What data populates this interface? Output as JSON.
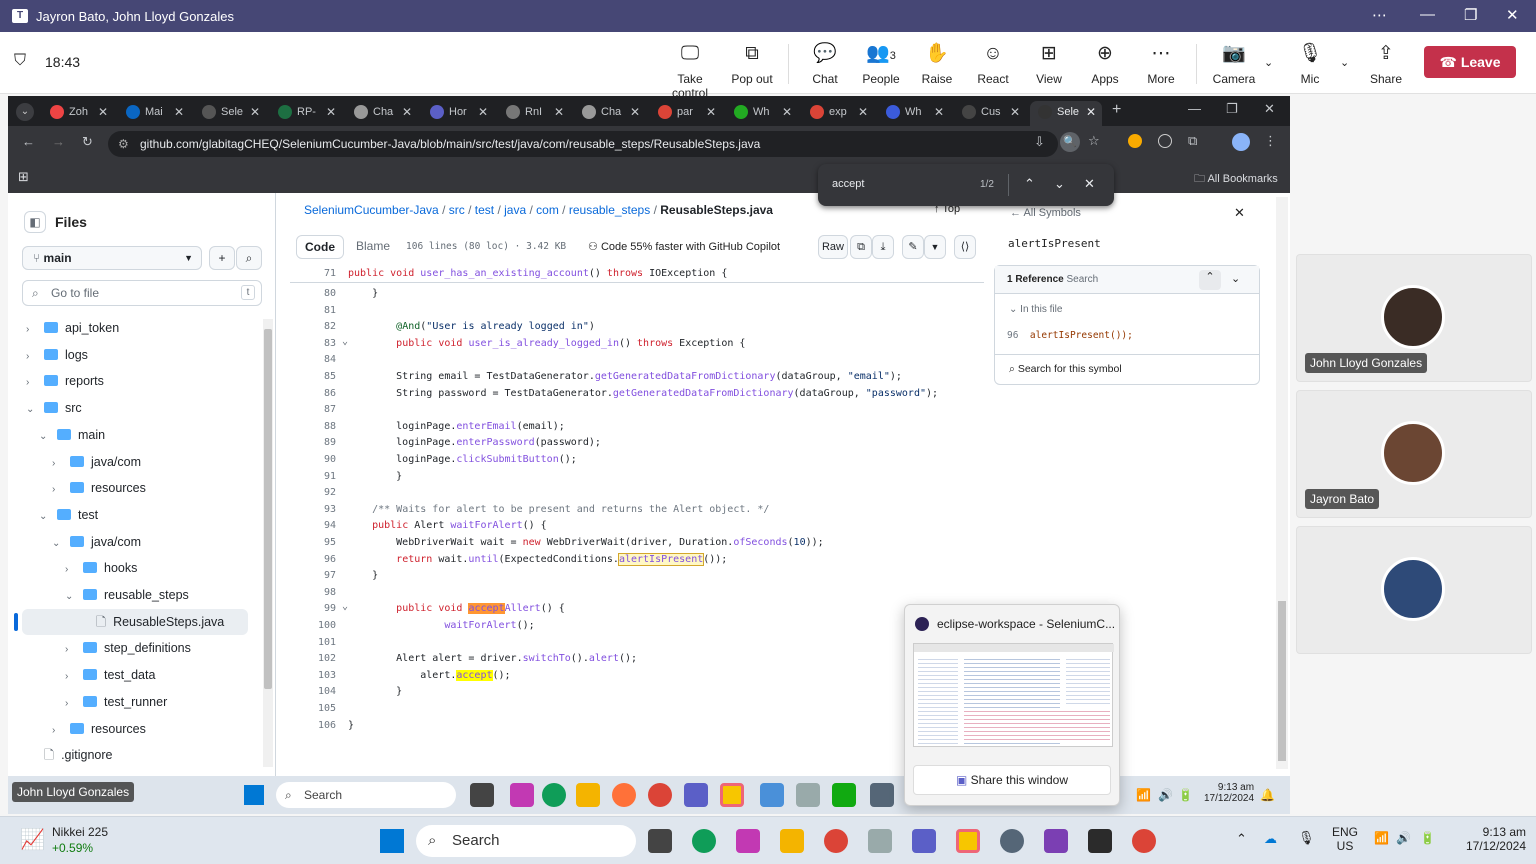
{
  "teams": {
    "window_title": "Jayron Bato, John Lloyd Gonzales",
    "time": "18:43",
    "toolbar": [
      {
        "label": "Take control",
        "icon": "take-control-icon"
      },
      {
        "label": "Pop out",
        "icon": "pop-out-icon"
      },
      {
        "label": "Chat",
        "icon": "chat-icon"
      },
      {
        "label": "People",
        "icon": "people-icon",
        "count": "3"
      },
      {
        "label": "Raise",
        "icon": "raise-hand-icon"
      },
      {
        "label": "React",
        "icon": "react-icon"
      },
      {
        "label": "View",
        "icon": "view-icon"
      },
      {
        "label": "Apps",
        "icon": "apps-icon"
      },
      {
        "label": "More",
        "icon": "more-icon"
      },
      {
        "label": "Camera",
        "icon": "camera-off-icon"
      },
      {
        "label": "Mic",
        "icon": "mic-icon"
      },
      {
        "label": "Share",
        "icon": "share-icon"
      }
    ],
    "leave_label": "Leave",
    "participants": [
      "John Lloyd Gonzales",
      "Jayron Bato"
    ],
    "presenter_label": "John Lloyd Gonzales"
  },
  "browser": {
    "tabs": [
      "Zoh",
      "Mai",
      "Sele",
      "RP-",
      "Cha",
      "Hor",
      "RnI",
      "Cha",
      "par",
      "Wh",
      "exp",
      "Wh",
      "Cus",
      "Sele"
    ],
    "url": "github.com/glabitagCHEQ/SeleniumCucumber-Java/blob/main/src/test/java/com/reusable_steps/ReusableSteps.java",
    "bookmarks_label": "All Bookmarks",
    "find": {
      "query": "accept",
      "count": "1/2"
    }
  },
  "github": {
    "files_title": "Files",
    "branch": "main",
    "goto_placeholder": "Go to file",
    "goto_shortcut": "t",
    "tree": [
      {
        "label": "api_token",
        "indent": 0,
        "type": "folder",
        "open": false
      },
      {
        "label": "logs",
        "indent": 0,
        "type": "folder",
        "open": false
      },
      {
        "label": "reports",
        "indent": 0,
        "type": "folder",
        "open": false
      },
      {
        "label": "src",
        "indent": 0,
        "type": "folder",
        "open": true
      },
      {
        "label": "main",
        "indent": 1,
        "type": "folder",
        "open": true
      },
      {
        "label": "java/com",
        "indent": 2,
        "type": "folder",
        "open": false
      },
      {
        "label": "resources",
        "indent": 2,
        "type": "folder",
        "open": false
      },
      {
        "label": "test",
        "indent": 1,
        "type": "folder",
        "open": true
      },
      {
        "label": "java/com",
        "indent": 2,
        "type": "folder",
        "open": true
      },
      {
        "label": "hooks",
        "indent": 3,
        "type": "folder",
        "open": false
      },
      {
        "label": "reusable_steps",
        "indent": 3,
        "type": "folder",
        "open": true
      },
      {
        "label": "ReusableSteps.java",
        "indent": 4,
        "type": "file",
        "open": false
      },
      {
        "label": "step_definitions",
        "indent": 3,
        "type": "folder",
        "open": false
      },
      {
        "label": "test_data",
        "indent": 3,
        "type": "folder",
        "open": false
      },
      {
        "label": "test_runner",
        "indent": 3,
        "type": "folder",
        "open": false
      },
      {
        "label": "resources",
        "indent": 2,
        "type": "folder",
        "open": false
      },
      {
        "label": ".gitignore",
        "indent": 0,
        "type": "file",
        "open": false
      }
    ],
    "breadcrumb": [
      "SeleniumCucumber-Java",
      "src",
      "test",
      "java",
      "com",
      "reusable_steps"
    ],
    "file_name": "ReusableSteps.java",
    "top_label": "Top",
    "tab_code": "Code",
    "tab_blame": "Blame",
    "file_info": "106 lines (80 loc) · 3.42 KB",
    "copilot": "Code 55% faster with GitHub Copilot",
    "raw_label": "Raw",
    "sticky_line": {
      "num": "71",
      "html": "<span class=\"kw\">public</span> <span class=\"kw\">void</span> <span class=\"fn\">user_has_an_existing_account</span>() <span class=\"kw\">throws</span> IOException {"
    },
    "code_lines": [
      {
        "num": "80",
        "html": "    }"
      },
      {
        "num": "81",
        "html": ""
      },
      {
        "num": "82",
        "html": "        <span class=\"an\">@And</span>(<span class=\"st\">\"User is already logged in\"</span>)"
      },
      {
        "num": "83",
        "html": "        <span class=\"kw\">public</span> <span class=\"kw\">void</span> <span class=\"fn\">user_is_already_logged_in</span>() <span class=\"kw\">throws</span> Exception {"
      },
      {
        "num": "84",
        "html": ""
      },
      {
        "num": "85",
        "html": "        String email = TestDataGenerator.<span class=\"fn\">getGeneratedDataFromDictionary</span>(dataGroup, <span class=\"st\">\"email\"</span>);"
      },
      {
        "num": "86",
        "html": "        String password = TestDataGenerator.<span class=\"fn\">getGeneratedDataFromDictionary</span>(dataGroup, <span class=\"st\">\"password\"</span>);"
      },
      {
        "num": "87",
        "html": ""
      },
      {
        "num": "88",
        "html": "        loginPage.<span class=\"fn\">enterEmail</span>(email);"
      },
      {
        "num": "89",
        "html": "        loginPage.<span class=\"fn\">enterPassword</span>(password);"
      },
      {
        "num": "90",
        "html": "        loginPage.<span class=\"fn\">clickSubmitButton</span>();"
      },
      {
        "num": "91",
        "html": "        }"
      },
      {
        "num": "92",
        "html": ""
      },
      {
        "num": "93",
        "html": "    <span class=\"cm\">/** Waits for alert to be present and returns the Alert object. */</span>"
      },
      {
        "num": "94",
        "html": "    <span class=\"kw\">public</span> Alert <span class=\"fn\">waitForAlert</span>() {"
      },
      {
        "num": "95",
        "html": "        WebDriverWait wait = <span class=\"kw\">new</span> WebDriverWait(driver, Duration.<span class=\"fn\">ofSeconds</span>(<span class=\"st\">10</span>));"
      },
      {
        "num": "96",
        "html": "        <span class=\"kw\">return</span> wait.<span class=\"fn\">until</span>(ExpectedConditions.<span class=\"fn hl\">alertIsPresent</span>());"
      },
      {
        "num": "97",
        "html": "    }"
      },
      {
        "num": "98",
        "html": ""
      },
      {
        "num": "99",
        "html": "        <span class=\"kw\">public</span> <span class=\"kw\">void</span> <span class=\"fn\"><span class=\"hlo\">accept</span>Allert</span>() {"
      },
      {
        "num": "100",
        "html": "                <span class=\"fn\">waitForAlert</span>();"
      },
      {
        "num": "101",
        "html": ""
      },
      {
        "num": "102",
        "html": "        Alert alert = driver.<span class=\"fn\">switchTo</span>().<span class=\"fn\">alert</span>();"
      },
      {
        "num": "103",
        "html": "            alert.<span class=\"fn hly\">accept</span>();"
      },
      {
        "num": "104",
        "html": "        }"
      },
      {
        "num": "105",
        "html": ""
      },
      {
        "num": "106",
        "html": "}"
      }
    ],
    "symbols": {
      "back_label": "All Symbols",
      "symbol": "alertIsPresent",
      "ref_count": "1 Reference",
      "search_label": "Search",
      "in_file": "In this file",
      "ref_line": "96",
      "ref_code": "alertIsPresent());",
      "search_symbol": "Search for this symbol"
    }
  },
  "popup": {
    "title": "eclipse-workspace - SeleniumC...",
    "share": "Share this window"
  },
  "inner_taskbar": {
    "search": "Search",
    "time": "9:13 am",
    "date": "17/12/2024"
  },
  "taskbar": {
    "stock_name": "Nikkei 225",
    "stock_change": "+0.59%",
    "search": "Search",
    "lang1": "ENG",
    "lang2": "US",
    "time": "9:13 am",
    "date": "17/12/2024"
  }
}
